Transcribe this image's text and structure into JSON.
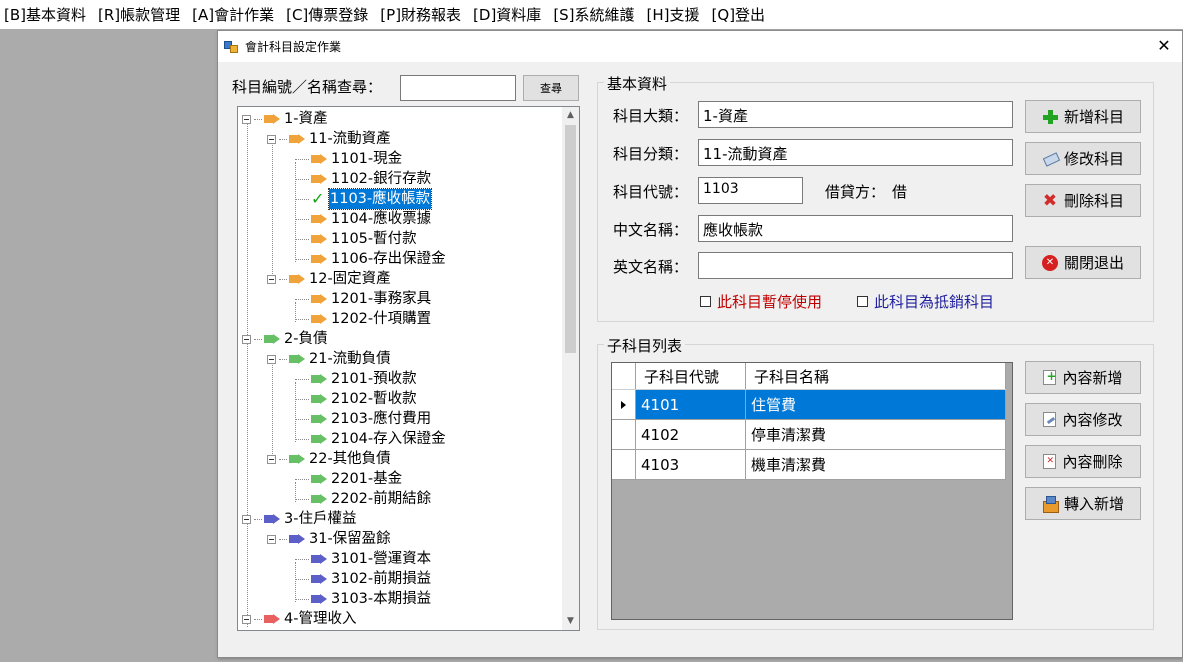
{
  "menu": [
    "[B]基本資料",
    "[R]帳款管理",
    "[A]會計作業",
    "[C]傳票登錄",
    "[P]財務報表",
    "[D]資料庫",
    "[S]系統維護",
    "[H]支援",
    "[Q]登出"
  ],
  "window": {
    "title": "會計科目設定作業",
    "close_glyph": "✕"
  },
  "search": {
    "label": "科目編號／名稱查尋：",
    "value": "",
    "button": "查尋"
  },
  "tree": {
    "colors": {
      "asset": "#f0a23b",
      "liability": "#67c065",
      "equity": "#5b5fc7",
      "income": "#e8605f"
    },
    "nodes": [
      {
        "label": "1-資產"
      },
      {
        "label": "11-流動資產"
      },
      {
        "label": "1101-現金"
      },
      {
        "label": "1102-銀行存款"
      },
      {
        "label": "1103-應收帳款"
      },
      {
        "label": "1104-應收票據"
      },
      {
        "label": "1105-暫付款"
      },
      {
        "label": "1106-存出保證金"
      },
      {
        "label": "12-固定資產"
      },
      {
        "label": "1201-事務家具"
      },
      {
        "label": "1202-什項購置"
      },
      {
        "label": "2-負債"
      },
      {
        "label": "21-流動負債"
      },
      {
        "label": "2101-預收款"
      },
      {
        "label": "2102-暫收款"
      },
      {
        "label": "2103-應付費用"
      },
      {
        "label": "2104-存入保證金"
      },
      {
        "label": "22-其他負債"
      },
      {
        "label": "2201-基金"
      },
      {
        "label": "2202-前期結餘"
      },
      {
        "label": "3-住戶權益"
      },
      {
        "label": "31-保留盈餘"
      },
      {
        "label": "3101-營運資本"
      },
      {
        "label": "3102-前期損益"
      },
      {
        "label": "3103-本期損益"
      },
      {
        "label": "4-管理收入"
      }
    ]
  },
  "basic": {
    "group_title": "基本資料",
    "category_label": "科目大類：",
    "category_value": "1-資產",
    "subcategory_label": "科目分類：",
    "subcategory_value": "11-流動資產",
    "code_label": "科目代號：",
    "code_value": "1103",
    "dc_label": "借貸方：",
    "dc_value": "借",
    "cname_label": "中文名稱：",
    "cname_value": "應收帳款",
    "ename_label": "英文名稱：",
    "ename_value": "",
    "suspend_label": "此科目暫停使用",
    "suspend_color": "#c00000",
    "offset_label": "此科目為抵銷科目",
    "offset_color": "#1f1f9f",
    "buttons": {
      "add": "新增科目",
      "edit": "修改科目",
      "delete": "刪除科目",
      "close": "關閉退出"
    }
  },
  "sub": {
    "group_title": "子科目列表",
    "columns": [
      "子科目代號",
      "子科目名稱"
    ],
    "rows": [
      {
        "code": "4101",
        "name": "住管費"
      },
      {
        "code": "4102",
        "name": "停車清潔費"
      },
      {
        "code": "4103",
        "name": "機車清潔費"
      }
    ],
    "buttons": {
      "add": "內容新增",
      "edit": "內容修改",
      "delete": "內容刪除",
      "import": "轉入新增"
    }
  }
}
